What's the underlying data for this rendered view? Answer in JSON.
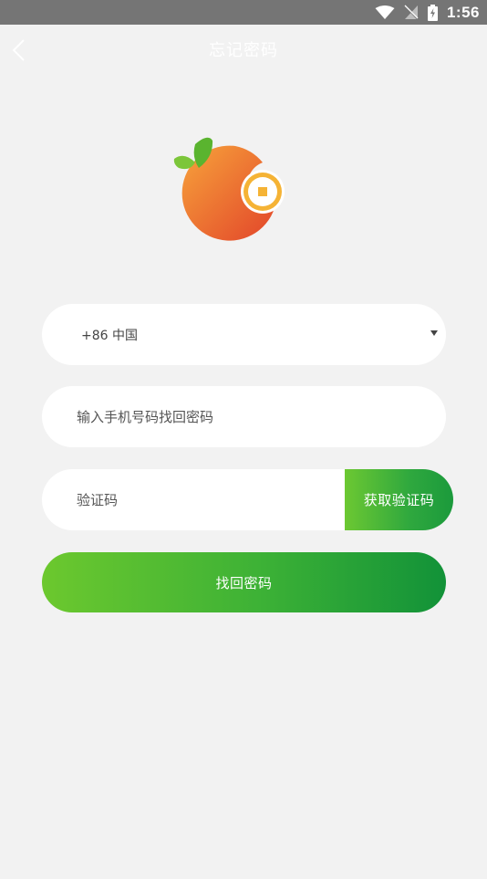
{
  "status_bar": {
    "time": "1:56",
    "icons": [
      "wifi-icon",
      "no-signal-icon",
      "battery-charging-icon"
    ]
  },
  "header": {
    "title": "忘记密码",
    "back_icon": "chevron-left-icon"
  },
  "logo": {
    "icon": "orange-coin-logo",
    "colors": {
      "fruit_start": "#f6a03a",
      "fruit_end": "#e44f2a",
      "leaf": "#5fb832",
      "coin": "#f5b335"
    }
  },
  "form": {
    "country": {
      "value": "+86 中国",
      "icon": "chevron-down-icon"
    },
    "phone": {
      "placeholder": "输入手机号码找回密码",
      "value": ""
    },
    "code": {
      "placeholder": "验证码",
      "value": ""
    },
    "get_code_label": "获取验证码",
    "submit_label": "找回密码"
  },
  "colors": {
    "background": "#f2f2f2",
    "status_bar": "#757575",
    "accent_green_light": "#6cc832",
    "accent_green_dark": "#129238"
  }
}
